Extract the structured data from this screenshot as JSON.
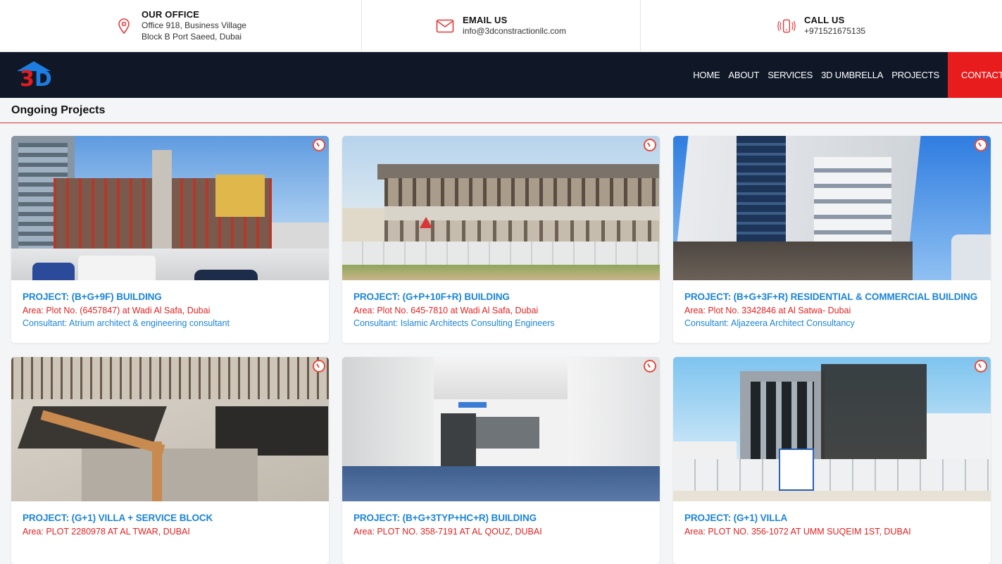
{
  "topbar": {
    "office": {
      "title": "OUR OFFICE",
      "line1": "Office 918, Business Village",
      "line2": "Block B Port Saeed, Dubai",
      "icon": "location-pin-icon"
    },
    "email": {
      "title": "EMAIL US",
      "value": "info@3dconstractionllc.com",
      "icon": "mail-icon"
    },
    "call": {
      "title": "CALL US",
      "value": "+971521675135",
      "icon": "phone-icon"
    }
  },
  "nav": {
    "logo_text_a": "3",
    "logo_text_b": "D",
    "items": [
      "HOME",
      "ABOUT",
      "SERVICES",
      "3D UMBRELLA",
      "PROJECTS"
    ],
    "cta": "CONTACT"
  },
  "section": {
    "title": "Ongoing Projects"
  },
  "projects": [
    {
      "title": "PROJECT: (B+G+9F) BUILDING",
      "area": "Area: Plot No. (6457847) at Wadi Al Safa, Dubai",
      "consultant": "Consultant: Atrium architect & engineering consultant"
    },
    {
      "title": "PROJECT: (G+P+10F+R) BUILDING",
      "area": "Area: Plot No. 645-7810 at Wadi Al Safa, Dubai",
      "consultant": "Consultant: Islamic Architects Consulting Engineers"
    },
    {
      "title": "PROJECT: (B+G+3F+R) RESIDENTIAL & COMMERCIAL BUILDING",
      "area": "Area: Plot No. 3342846 at Al Satwa- Dubai",
      "consultant": "Consultant: Aljazeera Architect Consultancy"
    },
    {
      "title": "PROJECT: (G+1) VILLA + SERVICE BLOCK",
      "area": "Area: PLOT 2280978 AT AL TWAR, DUBAI",
      "consultant": ""
    },
    {
      "title": "PROJECT: (B+G+3TYP+HC+R) BUILDING",
      "area": "Area: PLOT NO. 358-7191 AT AL QOUZ, DUBAI",
      "consultant": ""
    },
    {
      "title": "PROJECT: (G+1) VILLA",
      "area": "Area: PLOT NO. 356-1072 AT UMM SUQEIM 1ST, DUBAI",
      "consultant": ""
    }
  ],
  "colors": {
    "nav_bg": "#101828",
    "cta_bg": "#e81c1c",
    "link_blue": "#1b84d8",
    "area_red": "#e32020"
  }
}
